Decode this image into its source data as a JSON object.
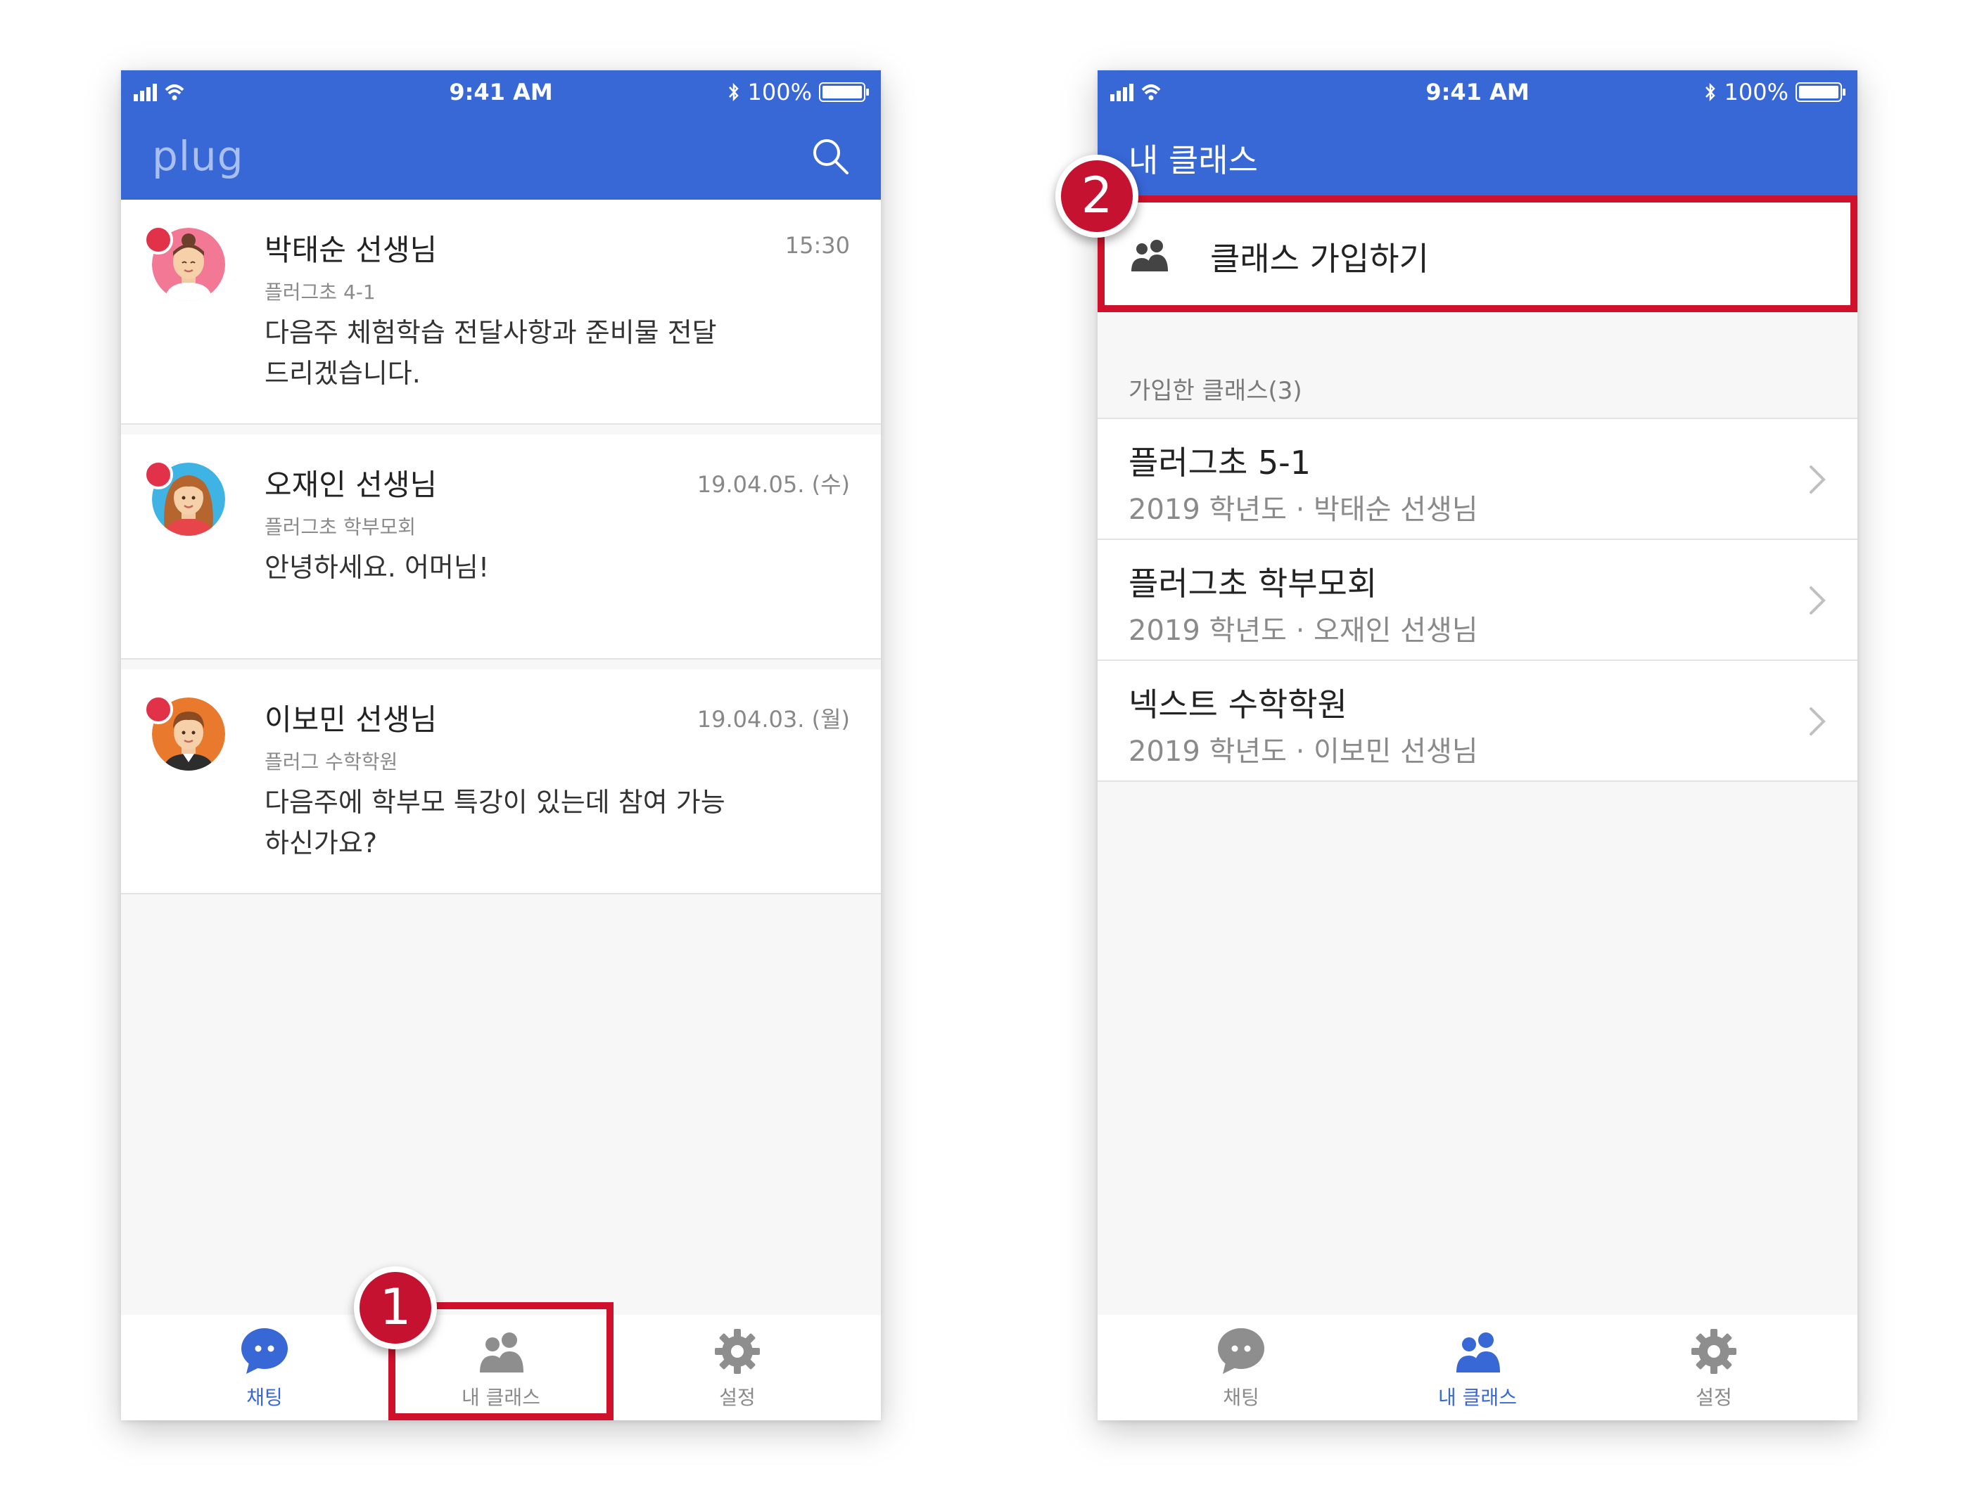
{
  "status_bar": {
    "time": "9:41 AM",
    "battery": "100%"
  },
  "left_screen": {
    "logo": "plug",
    "chats": [
      {
        "name": "박태순 선생님",
        "class": "플러그초 4-1",
        "time": "15:30",
        "message_lines": [
          "다음주 체험학습 전달사항과 준비물 전달",
          "드리겠습니다."
        ]
      },
      {
        "name": "오재인 선생님",
        "class": "플러그초 학부모회",
        "time": "19.04.05. (수)",
        "message_lines": [
          "안녕하세요. 어머님!",
          ""
        ]
      },
      {
        "name": "이보민 선생님",
        "class": "플러그 수학학원",
        "time": "19.04.03. (월)",
        "message_lines": [
          "다음주에 학부모 특강이 있는데 참여 가능",
          "하신가요?"
        ]
      }
    ],
    "tabs": [
      "채팅",
      "내 클래스",
      "설정"
    ],
    "active_tab": "채팅"
  },
  "right_screen": {
    "title": "내 클래스",
    "join_label": "클래스 가입하기",
    "section_header": "가입한 클래스(3)",
    "classes": [
      {
        "name": "플러그초 5-1",
        "sub": "2019 학년도 · 박태순 선생님"
      },
      {
        "name": "플러그초 학부모회",
        "sub": "2019 학년도 · 오재인 선생님"
      },
      {
        "name": "넥스트 수학학원",
        "sub": "2019 학년도 · 이보민 선생님"
      }
    ],
    "tabs": [
      "채팅",
      "내 클래스",
      "설정"
    ],
    "active_tab": "내 클래스"
  },
  "callouts": {
    "step1": "1",
    "step2": "2"
  },
  "colors": {
    "brand_blue": "#3867d6",
    "highlight_red": "#d0112b",
    "unread_dot": "#e2324a",
    "inactive_icon": "#8e8e8e"
  }
}
